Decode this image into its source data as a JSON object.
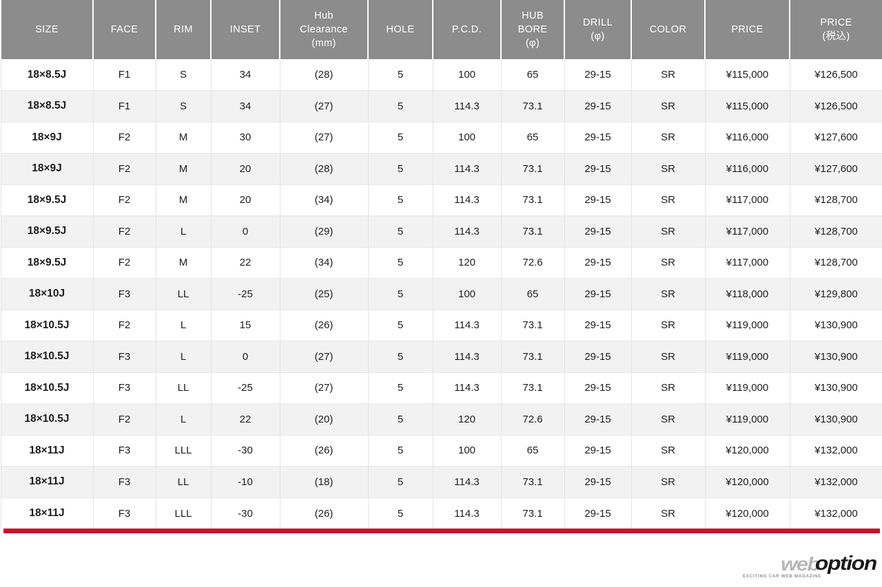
{
  "table": {
    "columns": [
      {
        "id": "size",
        "lines": [
          "SIZE"
        ]
      },
      {
        "id": "face",
        "lines": [
          "FACE"
        ]
      },
      {
        "id": "rim",
        "lines": [
          "RIM"
        ]
      },
      {
        "id": "inset",
        "lines": [
          "INSET"
        ]
      },
      {
        "id": "hub_clearance",
        "lines": [
          "Hub",
          "Clearance",
          "(mm)"
        ]
      },
      {
        "id": "hole",
        "lines": [
          "HOLE"
        ]
      },
      {
        "id": "pcd",
        "lines": [
          "P.C.D."
        ]
      },
      {
        "id": "hub_bore",
        "lines": [
          "HUB",
          "BORE",
          "(φ)"
        ]
      },
      {
        "id": "drill",
        "lines": [
          "DRILL",
          "(φ)"
        ]
      },
      {
        "id": "color",
        "lines": [
          "COLOR"
        ]
      },
      {
        "id": "price",
        "lines": [
          "PRICE"
        ]
      },
      {
        "id": "price_tax",
        "lines": [
          "PRICE",
          "(税込)"
        ]
      }
    ],
    "rows": [
      [
        "18×8.5J",
        "F1",
        "S",
        "34",
        "(28)",
        "5",
        "100",
        "65",
        "29-15",
        "SR",
        "¥115,000",
        "¥126,500"
      ],
      [
        "18×8.5J",
        "F1",
        "S",
        "34",
        "(27)",
        "5",
        "114.3",
        "73.1",
        "29-15",
        "SR",
        "¥115,000",
        "¥126,500"
      ],
      [
        "18×9J",
        "F2",
        "M",
        "30",
        "(27)",
        "5",
        "100",
        "65",
        "29-15",
        "SR",
        "¥116,000",
        "¥127,600"
      ],
      [
        "18×9J",
        "F2",
        "M",
        "20",
        "(28)",
        "5",
        "114.3",
        "73.1",
        "29-15",
        "SR",
        "¥116,000",
        "¥127,600"
      ],
      [
        "18×9.5J",
        "F2",
        "M",
        "20",
        "(34)",
        "5",
        "114.3",
        "73.1",
        "29-15",
        "SR",
        "¥117,000",
        "¥128,700"
      ],
      [
        "18×9.5J",
        "F2",
        "L",
        "0",
        "(29)",
        "5",
        "114.3",
        "73.1",
        "29-15",
        "SR",
        "¥117,000",
        "¥128,700"
      ],
      [
        "18×9.5J",
        "F2",
        "M",
        "22",
        "(34)",
        "5",
        "120",
        "72.6",
        "29-15",
        "SR",
        "¥117,000",
        "¥128,700"
      ],
      [
        "18×10J",
        "F3",
        "LL",
        "-25",
        "(25)",
        "5",
        "100",
        "65",
        "29-15",
        "SR",
        "¥118,000",
        "¥129,800"
      ],
      [
        "18×10.5J",
        "F2",
        "L",
        "15",
        "(26)",
        "5",
        "114.3",
        "73.1",
        "29-15",
        "SR",
        "¥119,000",
        "¥130,900"
      ],
      [
        "18×10.5J",
        "F3",
        "L",
        "0",
        "(27)",
        "5",
        "114.3",
        "73.1",
        "29-15",
        "SR",
        "¥119,000",
        "¥130,900"
      ],
      [
        "18×10.5J",
        "F3",
        "LL",
        "-25",
        "(27)",
        "5",
        "114.3",
        "73.1",
        "29-15",
        "SR",
        "¥119,000",
        "¥130,900"
      ],
      [
        "18×10.5J",
        "F2",
        "L",
        "22",
        "(20)",
        "5",
        "120",
        "72.6",
        "29-15",
        "SR",
        "¥119,000",
        "¥130,900"
      ],
      [
        "18×11J",
        "F3",
        "LLL",
        "-30",
        "(26)",
        "5",
        "100",
        "65",
        "29-15",
        "SR",
        "¥120,000",
        "¥132,000"
      ],
      [
        "18×11J",
        "F3",
        "LL",
        "-10",
        "(18)",
        "5",
        "114.3",
        "73.1",
        "29-15",
        "SR",
        "¥120,000",
        "¥132,000"
      ],
      [
        "18×11J",
        "F3",
        "LLL",
        "-30",
        "(26)",
        "5",
        "114.3",
        "73.1",
        "29-15",
        "SR",
        "¥120,000",
        "¥132,000"
      ]
    ]
  },
  "footer": {
    "logo_web": "web",
    "logo_option": "option",
    "logo_tagline": "EXCITING CAR WEB MAGAZINE"
  },
  "colors": {
    "header_bg": "#8c8c8c",
    "row_alt_bg": "#f2f2f2",
    "accent_rule": "#c9102a"
  }
}
